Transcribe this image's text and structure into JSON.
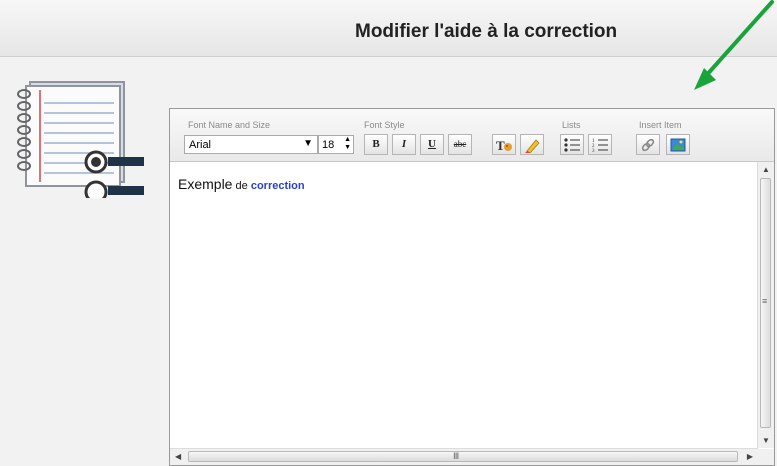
{
  "header": {
    "title": "Modifier l'aide à la correction"
  },
  "toolbar": {
    "font_group_label": "Font Name and Size",
    "style_group_label": "Font Style",
    "lists_group_label": "Lists",
    "insert_group_label": "Insert Item",
    "font_name": "Arial",
    "font_size": "18",
    "bold_label": "B",
    "italic_label": "I",
    "underline_label": "U",
    "strike_label": "abc"
  },
  "content": {
    "word1": "Exemple",
    "word2": " de ",
    "word3": "correction"
  },
  "colors": {
    "accent_arrow": "#1aa33b",
    "link_blue": "#2b3fd6"
  },
  "icons": [
    "notebook-icon",
    "arrow-icon",
    "font-color-icon",
    "highlight-icon",
    "bullet-list-icon",
    "numbered-list-icon",
    "link-icon",
    "image-icon"
  ]
}
